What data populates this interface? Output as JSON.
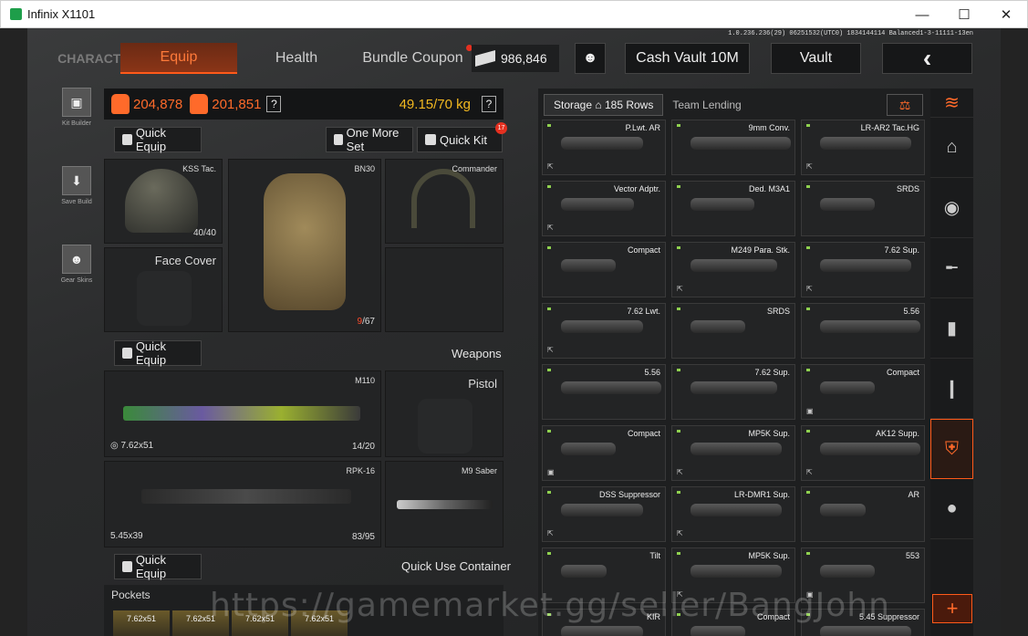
{
  "window": {
    "title": "Infinix X1101",
    "minimize": "—",
    "maximize": "☐",
    "close": "✕"
  },
  "version": "1.0.236.236(29) 06251532(UTC0) 1834144114 Balanced1-3-11111-13en",
  "tabs": {
    "character": "CHARACTER",
    "equip": "Equip",
    "health": "Health",
    "bundle": "Bundle Coupon"
  },
  "currency": {
    "cash": "986,846"
  },
  "header": {
    "cash_vault": "Cash Vault 10M",
    "vault": "Vault",
    "back": "‹"
  },
  "sidebar": [
    {
      "label": "Kit Builder",
      "icon": "kit-builder-icon"
    },
    {
      "label": "Save Build",
      "icon": "save-build-icon"
    },
    {
      "label": "Gear Skins",
      "icon": "gear-skins-icon"
    }
  ],
  "weights": {
    "value1": "204,878",
    "value2": "201,851",
    "kg": "49.15/70 kg",
    "help": "?"
  },
  "equip": {
    "quick_equip": "Quick Equip",
    "one_more_set": "One More Set",
    "quick_kit": "Quick Kit",
    "quick_kit_badge": "17",
    "helmet": {
      "name": "KSS Tac.",
      "count": "40/40"
    },
    "armor": {
      "name": "BN30",
      "count_red": "9",
      "count_rest": "/67"
    },
    "headset": {
      "name": "Commander"
    },
    "face": {
      "name": "Face Cover"
    }
  },
  "weapons": {
    "label": "Weapons",
    "quick_equip": "Quick Equip",
    "primary": {
      "name": "M110",
      "caliber": "7.62x51",
      "count": "14/20"
    },
    "secondary": {
      "name": "RPK-16",
      "caliber": "5.45x39",
      "count": "83/95"
    },
    "pistol": {
      "name": "Pistol"
    },
    "melee": {
      "name": "M9 Saber"
    }
  },
  "container": {
    "quick_equip": "Quick Equip",
    "label": "Quick Use Container"
  },
  "pockets": {
    "label": "Pockets",
    "cells": [
      "7.62x51",
      "7.62x51",
      "7.62x51",
      "7.62x51"
    ]
  },
  "storage": {
    "tab_storage": "Storage",
    "rows": "185 Rows",
    "tab_team": "Team Lending",
    "items": [
      {
        "name": "P.Lwt. AR",
        "mark": "⇱"
      },
      {
        "name": "9mm Conv.",
        "mark": ""
      },
      {
        "name": "LR-AR2 Tac.HG",
        "mark": "⇱"
      },
      {
        "name": "Vector Adptr.",
        "mark": "⇱"
      },
      {
        "name": "Ded. M3A1",
        "mark": ""
      },
      {
        "name": "SRDS",
        "mark": ""
      },
      {
        "name": "Compact",
        "mark": ""
      },
      {
        "name": "M249 Para. Stk.",
        "mark": "⇱"
      },
      {
        "name": "7.62 Sup.",
        "mark": "⇱"
      },
      {
        "name": "7.62 Lwt.",
        "mark": "⇱"
      },
      {
        "name": "SRDS",
        "mark": ""
      },
      {
        "name": "5.56",
        "mark": ""
      },
      {
        "name": "5.56",
        "mark": ""
      },
      {
        "name": "7.62 Sup.",
        "mark": ""
      },
      {
        "name": "Compact",
        "mark": "▣"
      },
      {
        "name": "Compact",
        "mark": "▣"
      },
      {
        "name": "MP5K Sup.",
        "mark": "⇱"
      },
      {
        "name": "AK12 Supp.",
        "mark": "⇱"
      },
      {
        "name": "DSS Suppressor",
        "mark": "⇱"
      },
      {
        "name": "LR-DMR1 Sup.",
        "mark": "⇱"
      },
      {
        "name": "AR",
        "mark": ""
      },
      {
        "name": "Tilt",
        "mark": ""
      },
      {
        "name": "MP5K Sup.",
        "mark": "⇱"
      },
      {
        "name": "553",
        "mark": "▣"
      },
      {
        "name": "KIR",
        "mark": ""
      },
      {
        "name": "Compact",
        "mark": ""
      },
      {
        "name": "5.45 Suppressor",
        "mark": ""
      }
    ]
  },
  "rightnav": [
    "filter-icon",
    "home-icon",
    "bag-icon",
    "rifle-icon",
    "magazine-icon",
    "ammo-icon",
    "armor-icon",
    "grenade-icon"
  ],
  "watermark": "https://gamemarket.gg/seller/BangJohn"
}
